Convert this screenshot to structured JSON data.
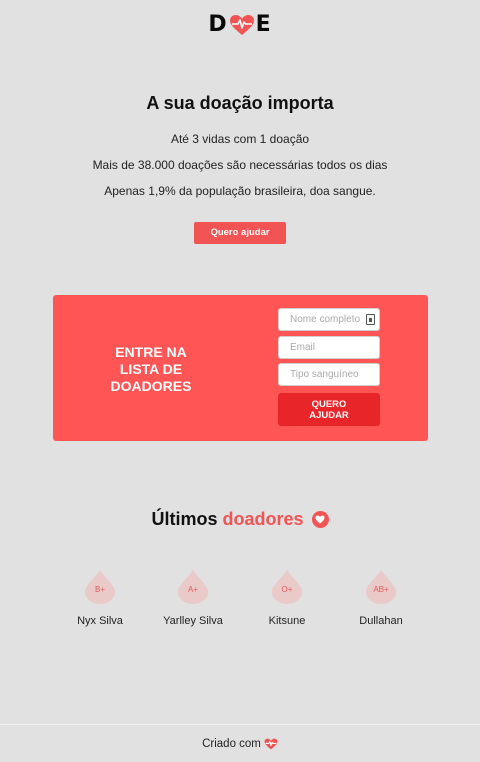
{
  "logo": {
    "left_letter": "D",
    "right_letter": "E",
    "icon": "heart-pulse-icon",
    "accent": "#f25353"
  },
  "hero": {
    "title": "A sua doação importa",
    "lines": [
      "Até 3 vidas com 1 doação",
      "Mais de 38.000 doações são necessárias todos os dias",
      "Apenas 1,9% da população brasileira, doa sangue."
    ],
    "cta_label": "Quero ajudar"
  },
  "signup": {
    "title": "ENTRE NA LISTA DE DOADORES",
    "fields": {
      "name_placeholder": "Nome completo",
      "email_placeholder": "Email",
      "blood_placeholder": "Tipo sanguíneo"
    },
    "submit_label": "QUERO AJUDAR",
    "background": "#ff5555",
    "button_color": "#e8262a"
  },
  "donors": {
    "title_prefix": "Últimos",
    "title_accent": "doadores",
    "icon": "heart-icon",
    "items": [
      {
        "blood_type": "B+",
        "name": "Nyx Silva"
      },
      {
        "blood_type": "A+",
        "name": "Yarlley Silva"
      },
      {
        "blood_type": "O+",
        "name": "Kitsune"
      },
      {
        "blood_type": "AB+",
        "name": "Dullahan"
      }
    ]
  },
  "footer": {
    "text": "Criado com",
    "icon": "heart-icon"
  }
}
